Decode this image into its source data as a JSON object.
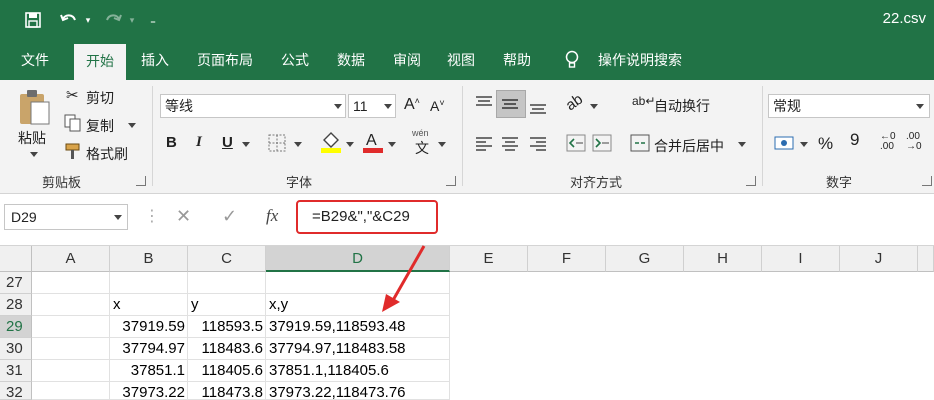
{
  "titlebar": {
    "filename": "22.csv"
  },
  "tabs": [
    "文件",
    "开始",
    "插入",
    "页面布局",
    "公式",
    "数据",
    "审阅",
    "视图",
    "帮助"
  ],
  "active_tab": "开始",
  "tell_me": "操作说明搜索",
  "clipboard": {
    "paste": "粘贴",
    "cut": "剪切",
    "copy": "复制",
    "format_painter": "格式刷",
    "label": "剪贴板"
  },
  "font": {
    "name": "等线",
    "size": "11",
    "bold": "B",
    "italic": "I",
    "underline": "U",
    "label": "字体",
    "phonetic": "wén"
  },
  "alignment": {
    "wrap": "自动换行",
    "merge": "合并后居中",
    "label": "对齐方式"
  },
  "number": {
    "format": "常规",
    "percent": "%",
    "comma": "9",
    "label": "数字"
  },
  "namebox": "D29",
  "formula": "=B29&\",\"&C29",
  "formula_bar": {
    "fx": "fx"
  },
  "colors": {
    "excel_green": "#217346",
    "highlight_red": "#e02b2b"
  },
  "columns": [
    "A",
    "B",
    "C",
    "D",
    "E",
    "F",
    "G",
    "H",
    "I",
    "J"
  ],
  "rows": [
    {
      "num": "27",
      "A": "",
      "B": "",
      "C": "",
      "D": ""
    },
    {
      "num": "28",
      "A": "",
      "B": "x",
      "C": "y",
      "D": "x,y"
    },
    {
      "num": "29",
      "A": "",
      "B": "37919.59",
      "C": "118593.5",
      "D": "37919.59,118593.48"
    },
    {
      "num": "30",
      "A": "",
      "B": "37794.97",
      "C": "118483.6",
      "D": "37794.97,118483.58"
    },
    {
      "num": "31",
      "A": "",
      "B": "37851.1",
      "C": "118405.6",
      "D": "37851.1,118405.6"
    },
    {
      "num": "32",
      "A": "",
      "B": "37973.22",
      "C": "118473.8",
      "D": "37973.22,118473.76"
    }
  ]
}
